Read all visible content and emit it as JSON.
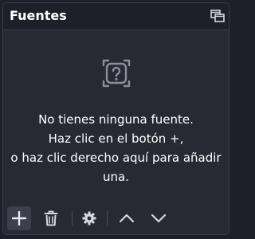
{
  "dock": {
    "title": "Fuentes",
    "float_icon": "undock-icon"
  },
  "empty_state": {
    "icon": "unknown-source-icon",
    "lines": [
      "No tienes ninguna fuente.",
      "Haz clic en el botón +,",
      "o haz clic derecho aquí para añadir",
      "una."
    ]
  },
  "toolbar": {
    "buttons": [
      {
        "icon": "plus-icon"
      },
      {
        "icon": "trash-icon"
      },
      {
        "icon": "gear-icon"
      },
      {
        "icon": "chevron-up-icon"
      },
      {
        "icon": "chevron-down-icon"
      }
    ]
  },
  "colors": {
    "background": "#1e1f28",
    "panel": "#272a33",
    "border": "#3a3d48",
    "icon": "#d6d7dc",
    "muted_icon": "#8c8f99",
    "text": "#ffffff",
    "active_button": "#3c404d"
  }
}
